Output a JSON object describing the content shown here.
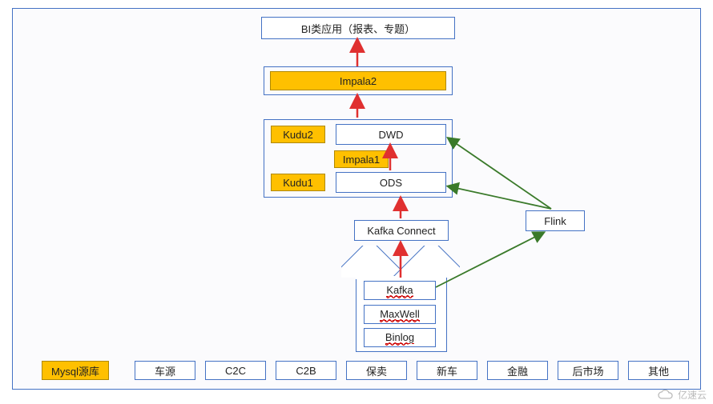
{
  "top": {
    "bi": "BI类应用（报表、专题）",
    "impala2": "Impala2"
  },
  "mid": {
    "kudu2": "Kudu2",
    "dwd": "DWD",
    "impala1": "Impala1",
    "kudu1": "Kudu1",
    "ods": "ODS"
  },
  "kafkaConnect": "Kafka Connect",
  "bigArrow": {
    "kafka": "Kafka",
    "maxwell": "MaxWell",
    "binlog": "Binlog"
  },
  "flink": "Flink",
  "sourceLabel": "Mysql源库",
  "sources": [
    "车源",
    "C2C",
    "C2B",
    "保卖",
    "新车",
    "金融",
    "后市场",
    "其他"
  ],
  "watermark": "亿速云",
  "chart_data": {
    "type": "flow-diagram",
    "nodes": [
      {
        "id": "bi",
        "label": "BI类应用（报表、专题）"
      },
      {
        "id": "impala2",
        "label": "Impala2",
        "highlight": true
      },
      {
        "id": "midContainer",
        "children": [
          "kudu2",
          "dwd",
          "impala1",
          "kudu1",
          "ods"
        ]
      },
      {
        "id": "kudu2",
        "label": "Kudu2",
        "highlight": true
      },
      {
        "id": "dwd",
        "label": "DWD"
      },
      {
        "id": "impala1",
        "label": "Impala1",
        "highlight": true
      },
      {
        "id": "kudu1",
        "label": "Kudu1",
        "highlight": true
      },
      {
        "id": "ods",
        "label": "ODS"
      },
      {
        "id": "kafkaConnect",
        "label": "Kafka Connect"
      },
      {
        "id": "kafka",
        "label": "Kafka"
      },
      {
        "id": "maxwell",
        "label": "MaxWell"
      },
      {
        "id": "binlog",
        "label": "Binlog"
      },
      {
        "id": "flink",
        "label": "Flink"
      },
      {
        "id": "mysqlSource",
        "label": "Mysql源库",
        "highlight": true
      },
      {
        "id": "src1",
        "label": "车源"
      },
      {
        "id": "src2",
        "label": "C2C"
      },
      {
        "id": "src3",
        "label": "C2B"
      },
      {
        "id": "src4",
        "label": "保卖"
      },
      {
        "id": "src5",
        "label": "新车"
      },
      {
        "id": "src6",
        "label": "金融"
      },
      {
        "id": "src7",
        "label": "后市场"
      },
      {
        "id": "src8",
        "label": "其他"
      }
    ],
    "edges": [
      {
        "from": "impala2",
        "to": "bi",
        "color": "red"
      },
      {
        "from": "midContainer",
        "to": "impala2",
        "color": "red"
      },
      {
        "from": "ods",
        "to": "dwd",
        "color": "red"
      },
      {
        "from": "kafkaConnect",
        "to": "ods",
        "color": "red"
      },
      {
        "from": "kafka",
        "to": "kafkaConnect",
        "color": "red"
      },
      {
        "from": "kafka",
        "to": "flink",
        "color": "green"
      },
      {
        "from": "flink",
        "to": "ods",
        "color": "green"
      },
      {
        "from": "flink",
        "to": "dwd",
        "color": "green"
      }
    ]
  }
}
